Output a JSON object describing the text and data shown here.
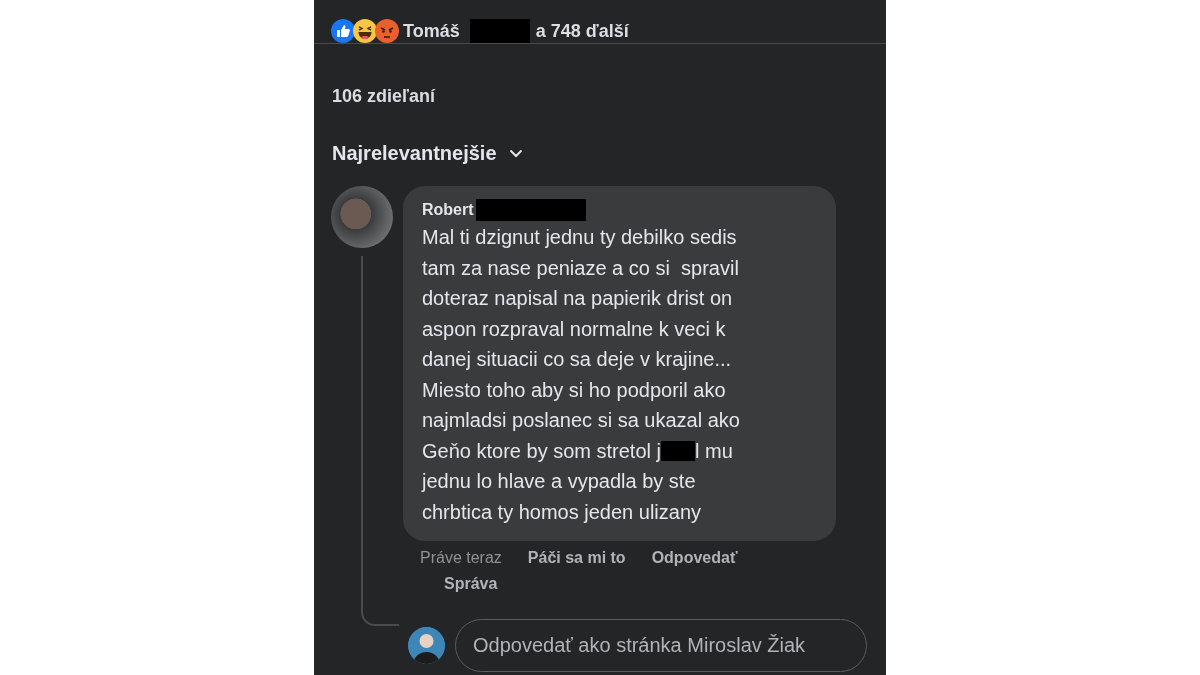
{
  "reactions": {
    "icons": [
      {
        "kind": "like"
      },
      {
        "kind": "haha"
      },
      {
        "kind": "angry"
      }
    ],
    "name": "Tomáš",
    "others": "a 748 ďalší"
  },
  "shares": "106 zdieľaní",
  "sort": {
    "label": "Najrelevantnejšie"
  },
  "comment": {
    "author": "Robert",
    "lines": [
      {
        "kind": "plain",
        "text": "Mal ti dzignut jednu ty debilko sedis"
      },
      {
        "kind": "plain",
        "text": "tam za nase peniaze a co si  spravil"
      },
      {
        "kind": "plain",
        "text": "doteraz napisal na papierik drist on"
      },
      {
        "kind": "plain",
        "text": "aspon rozpraval normalne k veci k"
      },
      {
        "kind": "plain",
        "text": "danej situacii co sa deje v krajine..."
      },
      {
        "kind": "plain",
        "text": "Miesto toho aby si ho podporil ako"
      },
      {
        "kind": "plain",
        "text": "najmladsi poslanec si sa ukazal ako"
      },
      {
        "kind": "redacted",
        "before": "Geňo ktore by som stretol j",
        "after": "l mu"
      },
      {
        "kind": "plain",
        "text": "jednu lo hlave a vypadla by ste"
      },
      {
        "kind": "plain",
        "text": "chrbtica ty homos jeden ulizany"
      }
    ],
    "actions": [
      {
        "label": "Práve teraz",
        "kind": "time"
      },
      {
        "label": "Páči sa mi to",
        "kind": "action"
      },
      {
        "label": "Odpovedať",
        "kind": "action"
      },
      {
        "label": "Správa",
        "kind": "action"
      }
    ]
  },
  "reply": {
    "placeholder": "Odpovedať ako stránka Miroslav Žiak"
  }
}
